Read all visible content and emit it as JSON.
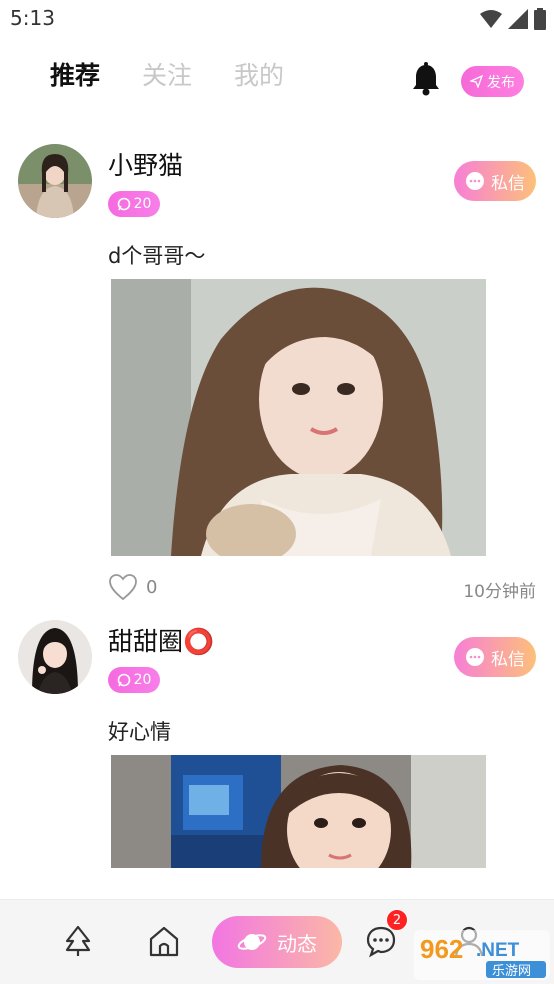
{
  "status_bar": {
    "time": "5:13"
  },
  "top_nav": {
    "tabs": [
      {
        "label": "推荐",
        "active": true
      },
      {
        "label": "关注",
        "active": false
      },
      {
        "label": "我的",
        "active": false
      }
    ],
    "publish_label": "发布"
  },
  "posts": [
    {
      "username": "小野猫",
      "level": "20",
      "dm_label": "私信",
      "text": "d个哥哥～",
      "likes": "0",
      "time": "10分钟前"
    },
    {
      "username": "甜甜圈⭕",
      "level": "20",
      "dm_label": "私信",
      "text": "好心情"
    }
  ],
  "bottom_nav": {
    "center_label": "动态",
    "message_badge": "2"
  },
  "watermark": {
    "text": "962.NET",
    "subtext": "乐游网"
  },
  "colors": {
    "accent_pink": "#f46ad8",
    "accent_orange": "#fcc07a"
  }
}
